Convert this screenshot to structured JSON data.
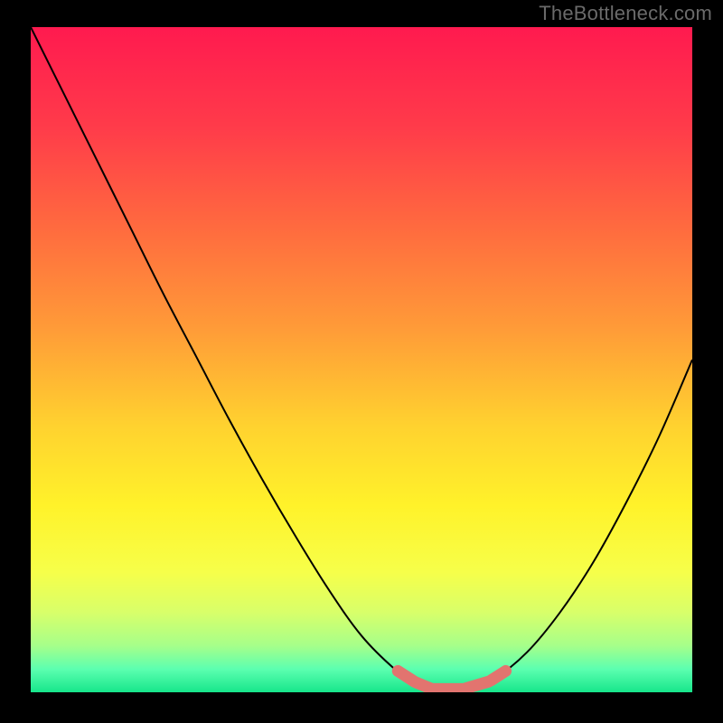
{
  "watermark": "TheBottleneck.com",
  "colors": {
    "background": "#000000",
    "watermark_text": "#6a6a6a",
    "curve_stroke": "#000000",
    "pill_fill": "#e2746f",
    "gradient_stops": [
      {
        "offset": 0.0,
        "color": "#ff1a4f"
      },
      {
        "offset": 0.15,
        "color": "#ff3b4a"
      },
      {
        "offset": 0.3,
        "color": "#ff6a3f"
      },
      {
        "offset": 0.45,
        "color": "#ff9a38"
      },
      {
        "offset": 0.6,
        "color": "#ffd22f"
      },
      {
        "offset": 0.72,
        "color": "#fff22a"
      },
      {
        "offset": 0.82,
        "color": "#f6ff4a"
      },
      {
        "offset": 0.88,
        "color": "#d8ff6a"
      },
      {
        "offset": 0.93,
        "color": "#a6ff8a"
      },
      {
        "offset": 0.965,
        "color": "#5cffb0"
      },
      {
        "offset": 1.0,
        "color": "#17e68b"
      }
    ]
  },
  "chart_data": {
    "type": "line",
    "title": "",
    "xlabel": "",
    "ylabel": "",
    "x": [
      0.0,
      0.05,
      0.1,
      0.15,
      0.2,
      0.25,
      0.3,
      0.35,
      0.4,
      0.45,
      0.5,
      0.55,
      0.58,
      0.6,
      0.63,
      0.66,
      0.7,
      0.75,
      0.8,
      0.85,
      0.9,
      0.95,
      1.0
    ],
    "values": [
      1.0,
      0.9,
      0.8,
      0.7,
      0.6,
      0.505,
      0.41,
      0.32,
      0.235,
      0.155,
      0.085,
      0.035,
      0.015,
      0.006,
      0.002,
      0.006,
      0.02,
      0.06,
      0.12,
      0.195,
      0.285,
      0.385,
      0.5
    ],
    "xlim": [
      0,
      1
    ],
    "ylim": [
      0,
      1
    ],
    "markers": [
      {
        "x0": 0.555,
        "y0": 0.032,
        "x1": 0.58,
        "y1": 0.016
      },
      {
        "x0": 0.582,
        "y0": 0.015,
        "x1": 0.604,
        "y1": 0.006
      },
      {
        "x0": 0.608,
        "y0": 0.005,
        "x1": 0.654,
        "y1": 0.005
      },
      {
        "x0": 0.658,
        "y0": 0.006,
        "x1": 0.692,
        "y1": 0.016
      },
      {
        "x0": 0.696,
        "y0": 0.018,
        "x1": 0.718,
        "y1": 0.032
      }
    ]
  }
}
